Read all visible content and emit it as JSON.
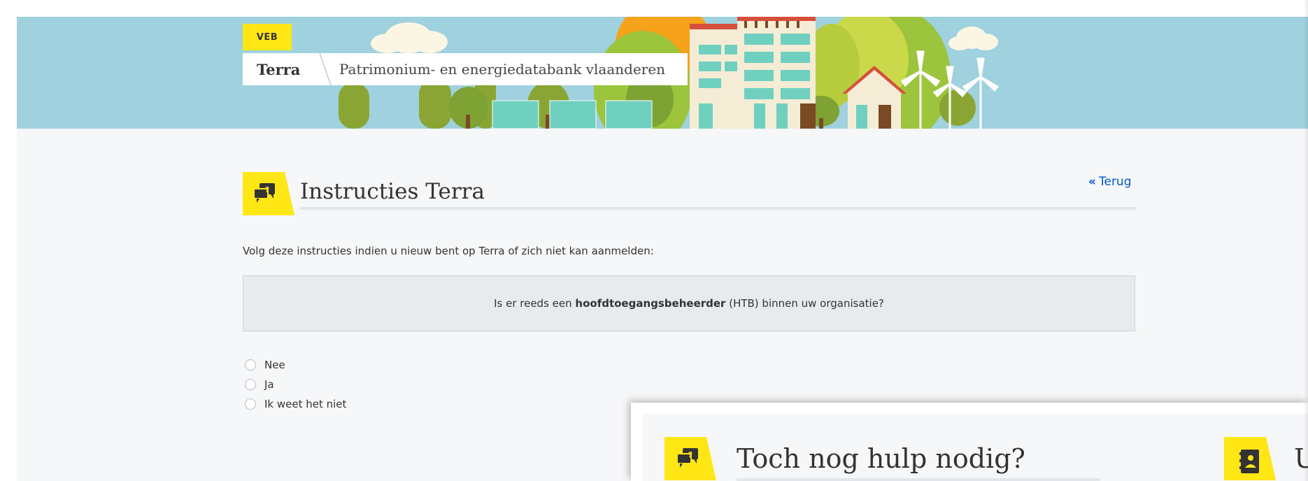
{
  "colors": {
    "banner_sky": "#9fd1de",
    "accent_yellow": "#ffe615",
    "link_blue": "#0055cc",
    "page_bg": "#f6f7f8",
    "question_bg": "#e8ebee"
  },
  "header": {
    "badge": "VEB",
    "brand": "Terra",
    "subtitle": "Patrimonium- en energiedatabank vlaanderen"
  },
  "main": {
    "icon": "question-chat-icon",
    "title": "Instructies Terra",
    "back_link": "Terug",
    "intro": "Volg deze instructies indien u nieuw bent op Terra of zich niet kan aanmelden:",
    "question": {
      "prefix": "Is er reeds een ",
      "bold": "hoofdtoegangsbeheerder",
      "suffix": " (HTB) binnen uw organisatie?"
    },
    "options": [
      "Nee",
      "Ja",
      "Ik weet het niet"
    ]
  },
  "help_panel": {
    "icon": "question-chat-icon",
    "title": "Toch nog hulp nodig?",
    "contact_icon": "contact-book-icon",
    "contact_title_partial": "U"
  }
}
